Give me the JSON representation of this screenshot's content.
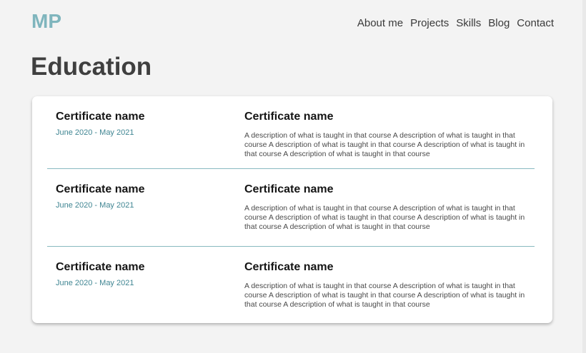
{
  "logo": "MP",
  "nav": [
    {
      "label": "About me"
    },
    {
      "label": "Projects"
    },
    {
      "label": "Skills"
    },
    {
      "label": "Blog"
    },
    {
      "label": "Contact"
    }
  ],
  "page_title": "Education",
  "entries": [
    {
      "certificate": "Certificate name",
      "date": "June 2020 - May 2021",
      "title": "Certificate name",
      "description": "A description of what is taught in that course A description of what is taught in that course A description of what is taught in that course A description of what is taught in that course A description of what is taught in that course"
    },
    {
      "certificate": "Certificate name",
      "date": "June 2020 - May 2021",
      "title": "Certificate name",
      "description": "A description of what is taught in that course A description of what is taught in that course A description of what is taught in that course A description of what is taught in that course A description of what is taught in that course"
    },
    {
      "certificate": "Certificate name",
      "date": "June 2020 - May 2021",
      "title": "Certificate name",
      "description": "A description of what is taught in that course A description of what is taught in that course A description of what is taught in that course A description of what is taught in that course A description of what is taught in that course"
    }
  ]
}
